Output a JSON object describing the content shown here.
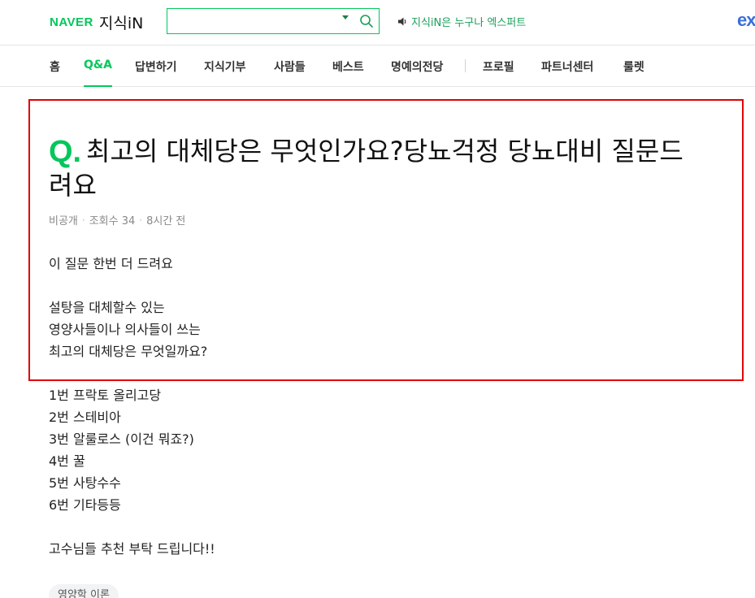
{
  "header": {
    "logo_brand": "NAVER",
    "logo_service": "지식iN",
    "search_placeholder": "",
    "promo_text": "지식iN은 누구나 엑스퍼트",
    "expert_logo": "ex",
    "accent_color": "#03c75a"
  },
  "nav": {
    "items": [
      {
        "label": "홈"
      },
      {
        "label": "Q&A"
      },
      {
        "label": "답변하기"
      },
      {
        "label": "지식기부"
      },
      {
        "label": "사람들"
      },
      {
        "label": "베스트"
      },
      {
        "label": "명예의전당"
      },
      {
        "label": "프로필"
      },
      {
        "label": "파트너센터"
      },
      {
        "label": "룰렛"
      }
    ],
    "active": "Q&A"
  },
  "question": {
    "mark": "Q.",
    "title_line1": "최고의 대체당은 무엇인가요?당뇨걱정 당뇨대비 질문드",
    "title_line2": "려요",
    "author": "비공개",
    "views": "조회수 34",
    "time": "8시간 전",
    "body": [
      "이 질문 한번 더 드려요",
      "설탕을 대체할수 있는",
      "영양사들이나 의사들이 쓰는",
      "최고의 대체당은 무엇일까요?",
      "1번 프락토 올리고당",
      "2번 스테비아",
      "3번 알룰로스 (이건 뭐죠?)",
      "4번 꿀",
      "5번 사탕수수",
      "6번 기타등등",
      "고수님들 추천 부탁 드립니다!!"
    ],
    "tag": "영양학 이론"
  }
}
